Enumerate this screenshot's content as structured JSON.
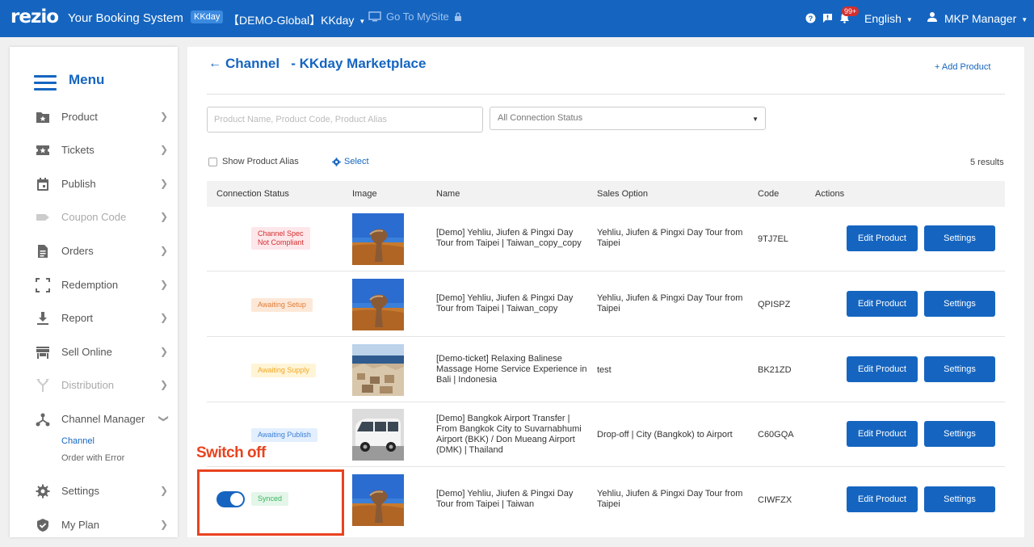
{
  "topbar": {
    "logo": "rezio",
    "title": "Your Booking System",
    "badge": "KKday",
    "demo_selector": "【DEMO-Global】KKday",
    "mysite": "Go To MySite",
    "notif_count": "99+",
    "language": "English",
    "user": "MKP Manager"
  },
  "sidebar": {
    "title": "Menu",
    "items": [
      {
        "label": "Product",
        "icon": "product-icon",
        "disabled": false
      },
      {
        "label": "Tickets",
        "icon": "tickets-icon",
        "disabled": false
      },
      {
        "label": "Publish",
        "icon": "calendar-icon",
        "disabled": false
      },
      {
        "label": "Coupon Code",
        "icon": "tag-icon",
        "disabled": true
      },
      {
        "label": "Orders",
        "icon": "document-icon",
        "disabled": false
      },
      {
        "label": "Redemption",
        "icon": "scan-icon",
        "disabled": false
      },
      {
        "label": "Report",
        "icon": "download-icon",
        "disabled": false
      },
      {
        "label": "Sell Online",
        "icon": "store-icon",
        "disabled": false
      },
      {
        "label": "Distribution",
        "icon": "fork-icon",
        "disabled": true
      },
      {
        "label": "Channel Manager",
        "icon": "network-icon",
        "disabled": false
      },
      {
        "label": "Settings",
        "icon": "gear-icon",
        "disabled": false
      },
      {
        "label": "My Plan",
        "icon": "shield-icon",
        "disabled": false
      }
    ],
    "subitems": [
      "Channel",
      "Order with Error"
    ]
  },
  "main": {
    "back": "←",
    "title": "Channel   - KKday Marketplace",
    "add_product": "+ Add Product",
    "search_placeholder": "Product Name, Product Code, Product Alias",
    "status_filter": "All Connection Status",
    "show_alias": "Show Product Alias",
    "select": "Select",
    "results": "5 results",
    "columns": [
      "Connection Status",
      "Image",
      "Name",
      "Sales Option",
      "Code",
      "Actions"
    ],
    "rows": [
      {
        "status": "Channel Spec\nNot Compliant",
        "status_color": "red",
        "name": "[Demo] Yehliu, Jiufen & Pingxi Day Tour from Taipei | Taiwan_copy_copy",
        "option": "Yehliu, Jiufen & Pingxi Day Tour from Taipei",
        "code": "9TJ7EL",
        "image": "rock-coast",
        "toggle": false
      },
      {
        "status": "Awaiting Setup",
        "status_color": "orange",
        "name": "[Demo] Yehliu, Jiufen & Pingxi Day Tour from Taipei | Taiwan_copy",
        "option": "Yehliu, Jiufen & Pingxi Day Tour from Taipei",
        "code": "QPISPZ",
        "image": "rock-coast",
        "toggle": false
      },
      {
        "status": "Awaiting Supply",
        "status_color": "yellow",
        "name": "[Demo-ticket] Relaxing Balinese Massage Home Service Experience in Bali | Indonesia",
        "option": "test",
        "code": "BK21ZD",
        "image": "cliff-houses",
        "toggle": false
      },
      {
        "status": "Awaiting Publish",
        "status_color": "blue",
        "name": "[Demo] Bangkok Airport Transfer | From Bangkok City to Suvarnabhumi Airport (BKK) / Don Mueang Airport (DMK) | Thailand",
        "option": "Drop-off | City (Bangkok) to Airport",
        "code": "C60GQA",
        "image": "white-van",
        "toggle": false
      },
      {
        "status": "Synced",
        "status_color": "green",
        "name": "[Demo] Yehliu, Jiufen & Pingxi Day Tour from Taipei | Taiwan",
        "option": "Yehliu, Jiufen & Pingxi Day Tour from Taipei",
        "code": "CIWFZX",
        "image": "rock-coast",
        "toggle": true
      }
    ],
    "edit_label": "Edit Product",
    "settings_label": "Settings"
  },
  "annotation": {
    "label": "Switch off",
    "color": "#e8431f"
  }
}
